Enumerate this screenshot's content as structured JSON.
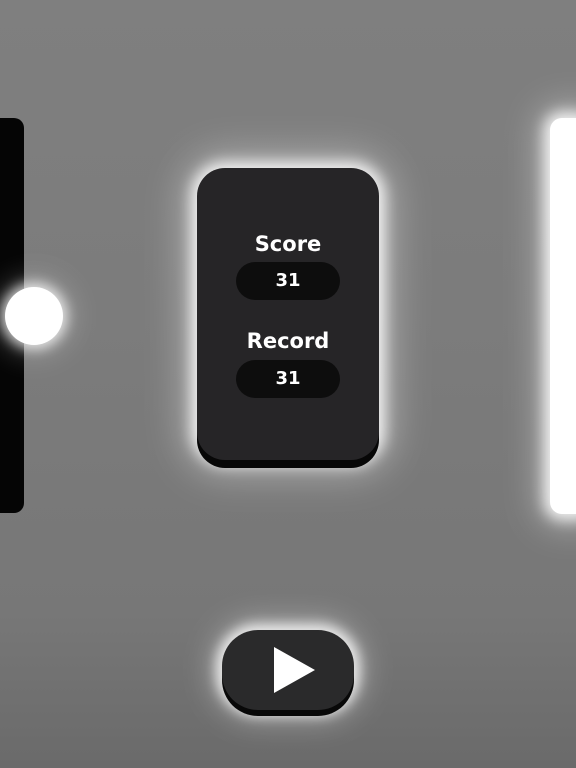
{
  "game": {
    "score_label": "Score",
    "score_value": "31",
    "record_label": "Record",
    "record_value": "31"
  },
  "controls": {
    "play_icon": "play-icon"
  },
  "colors": {
    "background": "#7c7c7c",
    "card": "#262527",
    "pill": "#0d0d0d",
    "left_paddle": "#050505",
    "right_paddle": "#ffffff",
    "ball": "#ffffff"
  }
}
